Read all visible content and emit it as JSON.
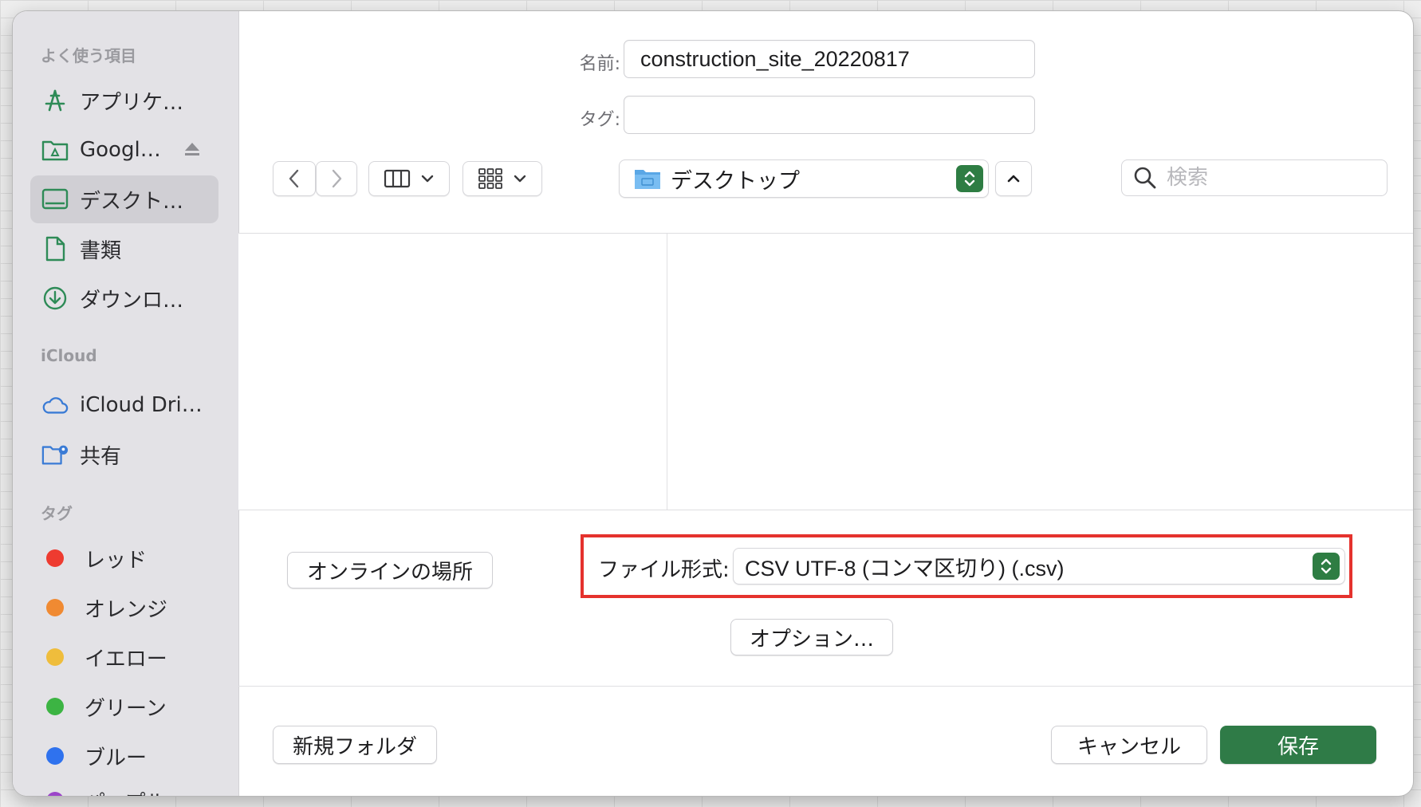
{
  "colors": {
    "accent_green": "#2f7b47",
    "highlight_red": "#e5322d",
    "sidebar_bg": "#e3e2e6"
  },
  "sidebar": {
    "favorites_heading": "よく使う項目",
    "favorites": [
      {
        "label": "アプリケ…",
        "icon": "applications-icon"
      },
      {
        "label": "Googl…",
        "icon": "google-drive-folder-icon",
        "ejectable": true
      },
      {
        "label": "デスクト…",
        "icon": "desktop-icon",
        "selected": true
      },
      {
        "label": "書類",
        "icon": "document-icon"
      },
      {
        "label": "ダウンロ…",
        "icon": "downloads-icon"
      }
    ],
    "icloud_heading": "iCloud",
    "icloud": [
      {
        "label": "iCloud Dri…",
        "icon": "cloud-icon"
      },
      {
        "label": "共有",
        "icon": "shared-folder-icon"
      }
    ],
    "tags_heading": "タグ",
    "tags": [
      {
        "label": "レッド",
        "color": "#ee3b30"
      },
      {
        "label": "オレンジ",
        "color": "#f08a32"
      },
      {
        "label": "イエロー",
        "color": "#efbd3c"
      },
      {
        "label": "グリーン",
        "color": "#3cb443"
      },
      {
        "label": "ブルー",
        "color": "#2f72ee"
      },
      {
        "label": "パープル",
        "color": "#9c45c9"
      }
    ]
  },
  "form": {
    "name_label": "名前:",
    "name_value": "construction_site_20220817",
    "tags_label": "タグ:",
    "tags_value": ""
  },
  "toolbar": {
    "location": "デスクトップ",
    "search_placeholder": "検索"
  },
  "bottom": {
    "online_locations_button": "オンラインの場所",
    "format_label": "ファイル形式:",
    "format_value": "CSV UTF-8 (コンマ区切り) (.csv)",
    "options_button": "オプション…",
    "new_folder_button": "新規フォルダ",
    "cancel_button": "キャンセル",
    "save_button": "保存"
  }
}
